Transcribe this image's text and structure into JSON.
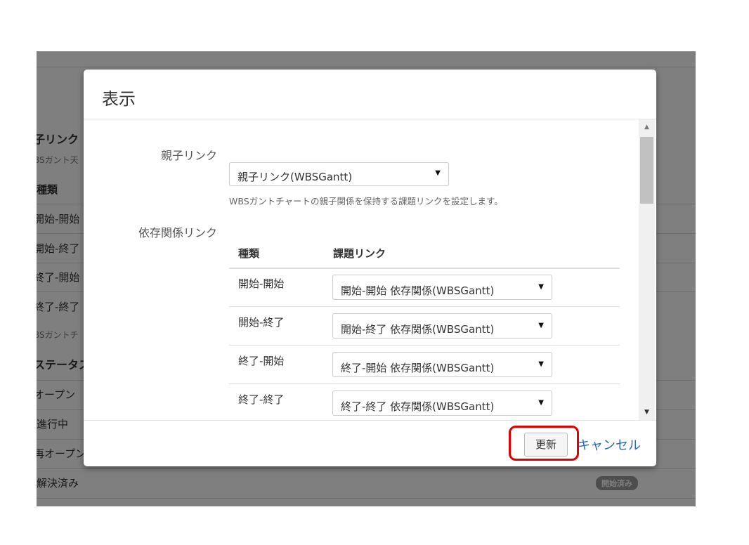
{
  "background": {
    "items": [
      {
        "text": "子リンク",
        "style": "bold"
      },
      {
        "text": "BSガント天",
        "style": "small"
      },
      {
        "text": "種類",
        "style": "bold"
      },
      {
        "text": "開始-開始",
        "style": "normal"
      },
      {
        "text": "開始-終了",
        "style": "normal"
      },
      {
        "text": "終了-開始",
        "style": "normal"
      },
      {
        "text": "終了-終了",
        "style": "normal"
      },
      {
        "text": "BSガントチ",
        "style": "small"
      },
      {
        "text": "ステータス",
        "style": "bold"
      },
      {
        "text": "オープン",
        "style": "normal"
      },
      {
        "text": "進行中",
        "style": "normal"
      },
      {
        "text": "再オープン",
        "style": "normal"
      },
      {
        "text": "解決済み",
        "style": "normal"
      }
    ],
    "badge": "開始済み"
  },
  "modal": {
    "title": "表示",
    "parent_link": {
      "label": "親子リンク",
      "selected": "親子リンク(WBSGantt)",
      "help": "WBSガントチャートの親子関係を保持する課題リンクを設定します。"
    },
    "dependency": {
      "label": "依存関係リンク",
      "header_type": "種類",
      "header_link": "課題リンク",
      "rows": [
        {
          "type": "開始-開始",
          "link": "開始-開始 依存関係(WBSGantt)"
        },
        {
          "type": "開始-終了",
          "link": "開始-終了 依存関係(WBSGantt)"
        },
        {
          "type": "終了-開始",
          "link": "終了-開始 依存関係(WBSGantt)"
        },
        {
          "type": "終了-終了",
          "link": "終了-終了 依存関係(WBSGantt)"
        }
      ]
    },
    "footer": {
      "update_label": "更新",
      "cancel_label": "キャンセル"
    }
  },
  "colors": {
    "highlight": "#e00000",
    "link": "#2a6bb5"
  }
}
